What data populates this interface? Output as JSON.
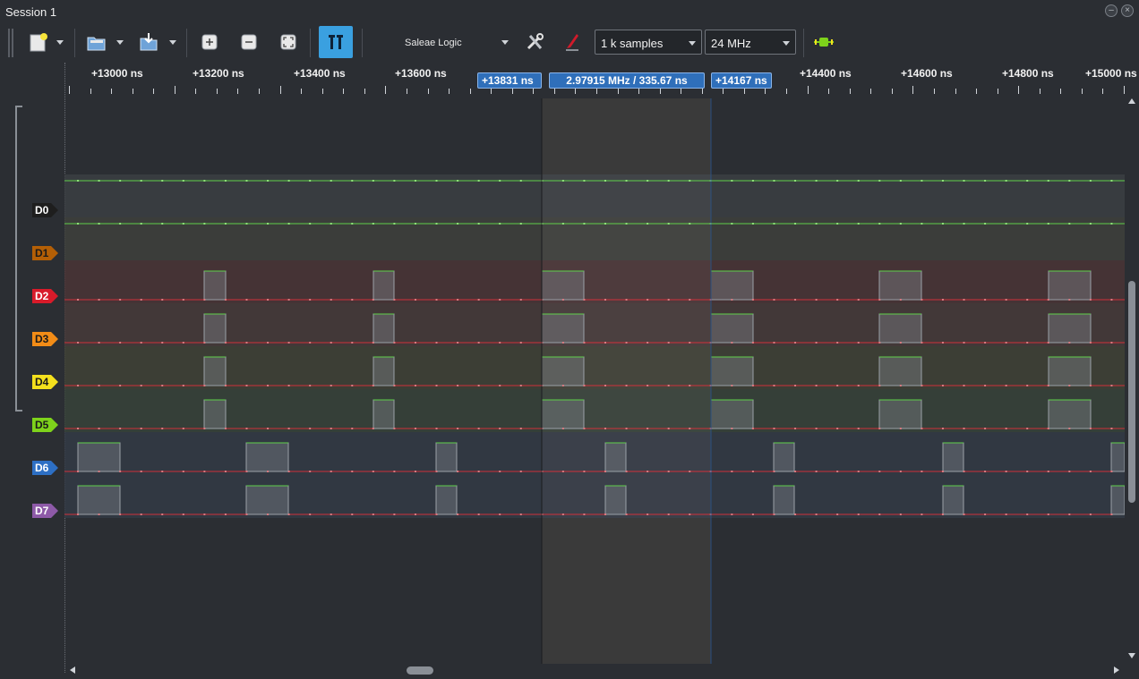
{
  "window": {
    "title": "Session 1"
  },
  "toolbar": {
    "device_label": "Saleae Logic",
    "samples": "1 k samples",
    "rate": "24 MHz",
    "icons": [
      "new-session-icon",
      "open-icon",
      "export-icon",
      "zoom-in-icon",
      "zoom-out-icon",
      "zoom-fit-icon",
      "cursor-mode-icon",
      "settings-icon",
      "annotate-icon",
      "start-capture-icon"
    ]
  },
  "ruler": {
    "labels": [
      "+13000 ns",
      "+13200 ns",
      "+13400 ns",
      "+13600 ns",
      "+14400 ns",
      "+14600 ns",
      "+14800 ns",
      "+15000 ns"
    ]
  },
  "markers": {
    "left": "+13831 ns",
    "delta": "2.97915 MHz / 335.67 ns",
    "right": "+14167 ns"
  },
  "channels": [
    {
      "name": "D0",
      "color": "#1e1e1e",
      "text_color": "#ffffff"
    },
    {
      "name": "D1",
      "color": "#b45f06",
      "text_color": "#1a1a1a"
    },
    {
      "name": "D2",
      "color": "#d81b2a",
      "text_color": "#ffffff"
    },
    {
      "name": "D3",
      "color": "#f28c17",
      "text_color": "#1a1a1a"
    },
    {
      "name": "D4",
      "color": "#f4e01d",
      "text_color": "#1a1a1a"
    },
    {
      "name": "D5",
      "color": "#7ed21b",
      "text_color": "#1a1a1a"
    },
    {
      "name": "D6",
      "color": "#2d6fc4",
      "text_color": "#ffffff"
    },
    {
      "name": "D7",
      "color": "#8e5aa8",
      "text_color": "#ffffff"
    }
  ]
}
